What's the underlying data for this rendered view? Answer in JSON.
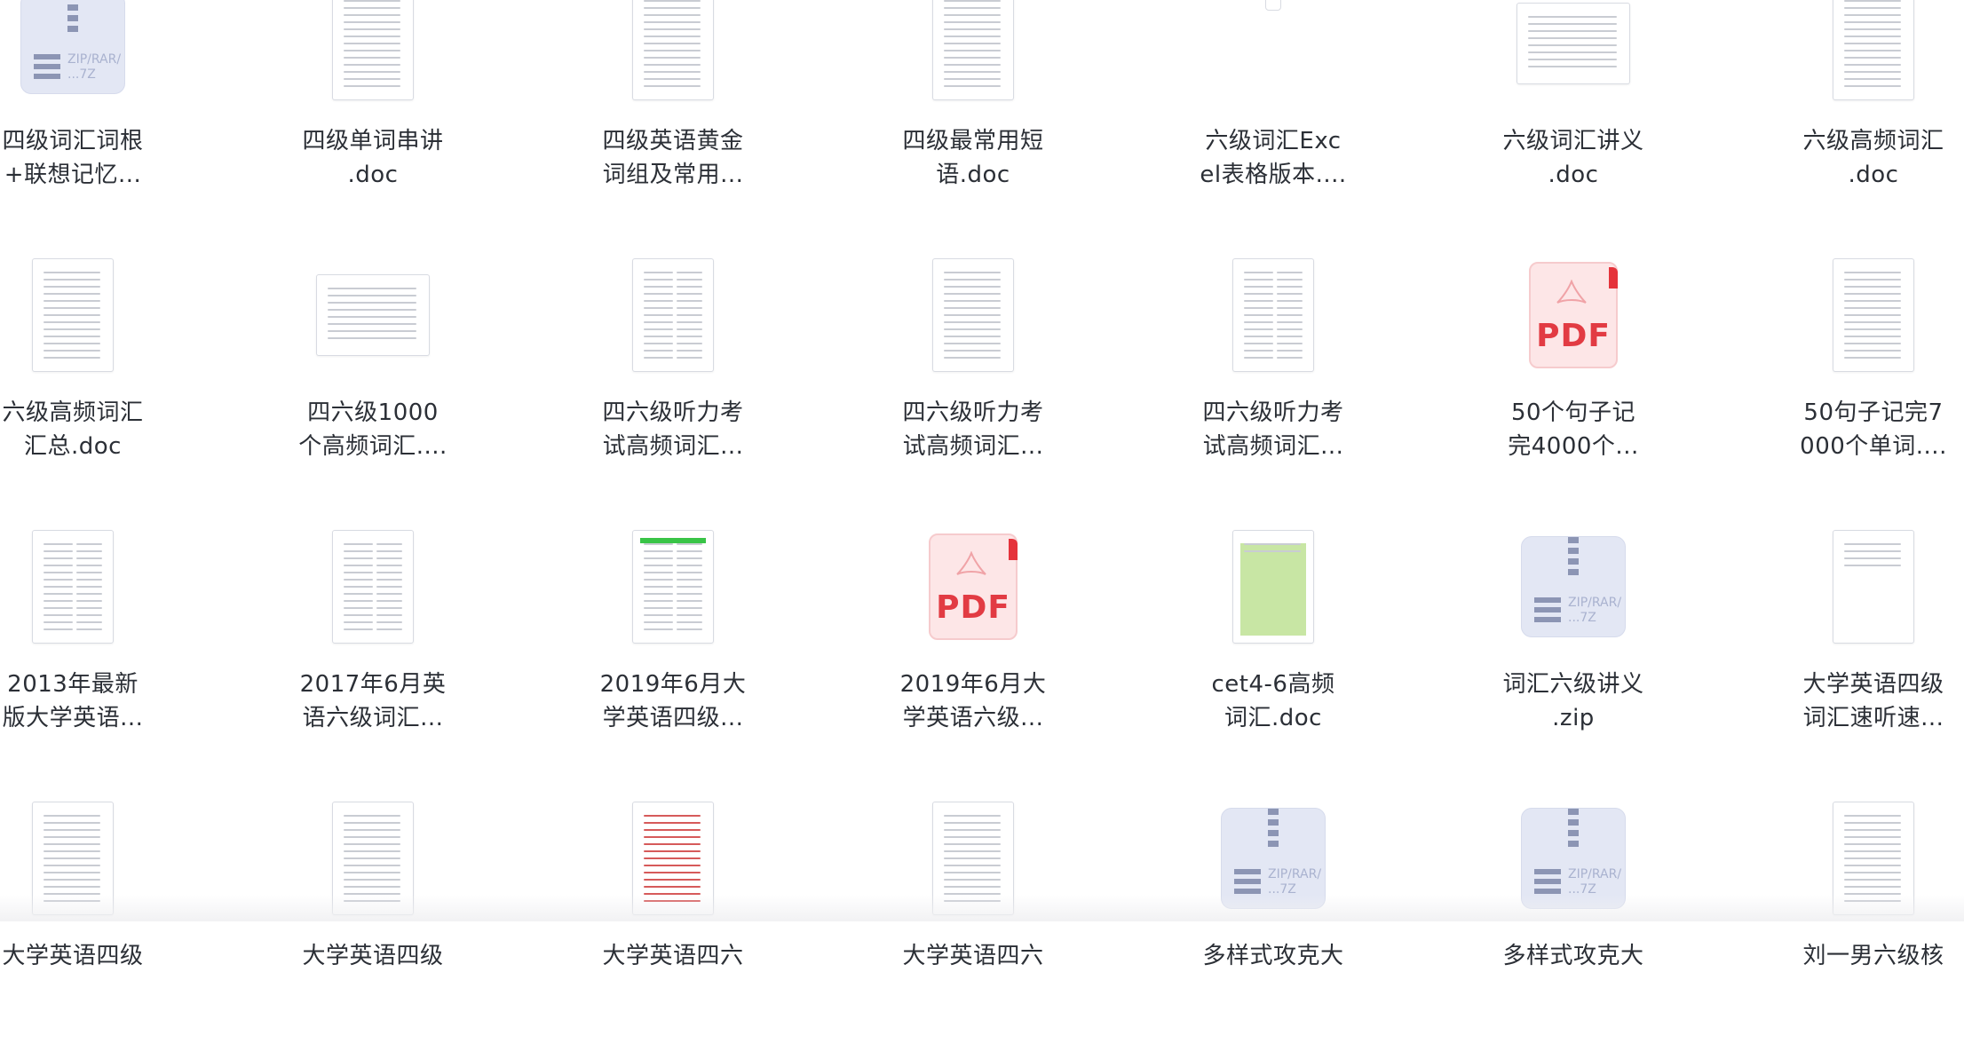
{
  "files": [
    {
      "label": "四级词汇词根\n+联想记忆...",
      "icon": "zip"
    },
    {
      "label": "四级单词串讲\n.doc",
      "icon": "doc"
    },
    {
      "label": "四级英语黄金\n词组及常用...",
      "icon": "doc"
    },
    {
      "label": "四级最常用短\n语.doc",
      "icon": "doc"
    },
    {
      "label": "六级词汇Exc\nel表格版本....",
      "icon": "narrow"
    },
    {
      "label": "六级词汇讲义\n.doc",
      "icon": "doc-wide"
    },
    {
      "label": "六级高频词汇\n.doc",
      "icon": "doc"
    },
    {
      "label": "六级高频词汇\n汇总.doc",
      "icon": "doc"
    },
    {
      "label": "四六级1000\n个高频词汇....",
      "icon": "doc-wide"
    },
    {
      "label": "四六级听力考\n试高频词汇...",
      "icon": "doc-cols"
    },
    {
      "label": "四六级听力考\n试高频词汇...",
      "icon": "doc"
    },
    {
      "label": "四六级听力考\n试高频词汇...",
      "icon": "doc-cols"
    },
    {
      "label": "50个句子记\n完4000个...",
      "icon": "pdf"
    },
    {
      "label": "50句子记完7\n000个单词....",
      "icon": "doc"
    },
    {
      "label": "2013年最新\n版大学英语...",
      "icon": "doc-cols"
    },
    {
      "label": "2017年6月英\n语六级词汇...",
      "icon": "doc-cols"
    },
    {
      "label": "2019年6月大\n学英语四级...",
      "icon": "doc-green"
    },
    {
      "label": "2019年6月大\n学英语六级...",
      "icon": "pdf"
    },
    {
      "label": "cet4-6高频\n词汇.doc",
      "icon": "doc-greenfill"
    },
    {
      "label": "词汇六级讲义\n.zip",
      "icon": "zip"
    },
    {
      "label": "大学英语四级\n词汇速听速...",
      "icon": "doc-title"
    },
    {
      "label": "大学英语四级",
      "icon": "doc"
    },
    {
      "label": "大学英语四级",
      "icon": "doc"
    },
    {
      "label": "大学英语四六",
      "icon": "doc-red"
    },
    {
      "label": "大学英语四六",
      "icon": "doc"
    },
    {
      "label": "多样式攻克大",
      "icon": "zip"
    },
    {
      "label": "多样式攻克大",
      "icon": "zip"
    },
    {
      "label": "刘一男六级核",
      "icon": "doc"
    }
  ],
  "icons": {
    "pdf_text": "PDF",
    "zip_text": "ZIP/RAR/\n...7Z"
  },
  "colors": {
    "background": "#ffffff",
    "label": "#2b2f36",
    "pdf_red": "#e23b43",
    "zip_blue": "#8c95b4"
  }
}
